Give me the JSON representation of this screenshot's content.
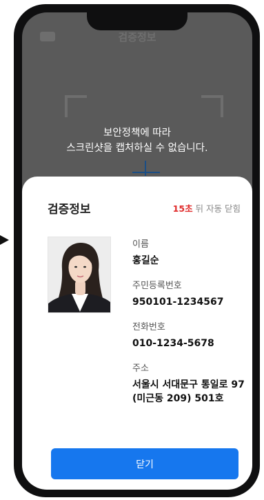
{
  "background": {
    "header_title": "검증정보",
    "notice_line1": "보안정책에 따라",
    "notice_line2": "스크린샷을 캡처하실 수 없습니다."
  },
  "sheet": {
    "title": "검증정보",
    "countdown_seconds": "15초",
    "countdown_suffix": " 뒤 자동 닫힘",
    "fields": [
      {
        "label": "이름",
        "value": "홍길순"
      },
      {
        "label": "주민등록번호",
        "value": "950101-1234567"
      },
      {
        "label": "전화번호",
        "value": "010-1234-5678"
      },
      {
        "label": "주소",
        "value": "서울시 서대문구 통일로 97\n(미근동 209) 501호"
      }
    ],
    "close_label": "닫기"
  },
  "colors": {
    "accent": "#1677ee",
    "countdown_accent": "#e02b2b",
    "overlay": "#5a5a5a"
  },
  "icons": {
    "pointer": "arrow-right-icon",
    "profile_photo": "id-photo"
  }
}
